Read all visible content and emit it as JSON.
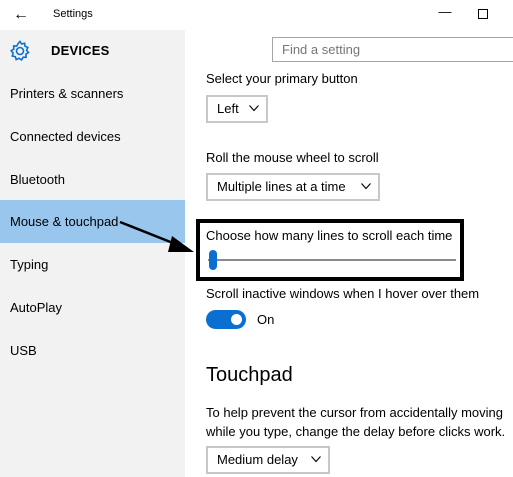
{
  "titlebar": {
    "title": "Settings",
    "back_glyph": "←",
    "minimize_glyph": "—"
  },
  "header": {
    "section_title": "DEVICES",
    "search_placeholder": "Find a setting"
  },
  "sidebar": {
    "items": [
      {
        "label": "Printers & scanners"
      },
      {
        "label": "Connected devices"
      },
      {
        "label": "Bluetooth"
      },
      {
        "label": "Mouse & touchpad",
        "selected": true
      },
      {
        "label": "Typing"
      },
      {
        "label": "AutoPlay"
      },
      {
        "label": "USB"
      }
    ]
  },
  "mouse": {
    "primary_button_label": "Select your primary button",
    "primary_button_value": "Left",
    "scroll_wheel_label": "Roll the mouse wheel to scroll",
    "scroll_wheel_value": "Multiple lines at a time",
    "lines_label": "Choose how many lines to scroll each time",
    "lines_slider_fraction": 0.0,
    "inactive_label": "Scroll inactive windows when I hover over them",
    "inactive_state": "On",
    "inactive_on": true
  },
  "touchpad": {
    "heading": "Touchpad",
    "description_line1": "To help prevent the cursor from accidentally moving",
    "description_line2": "while you type, change the delay before clicks work.",
    "delay_value": "Medium delay"
  },
  "colors": {
    "accent": "#0b6fd1",
    "selected_nav": "#99c6ed",
    "sidebar_bg": "#f2f2f2"
  }
}
